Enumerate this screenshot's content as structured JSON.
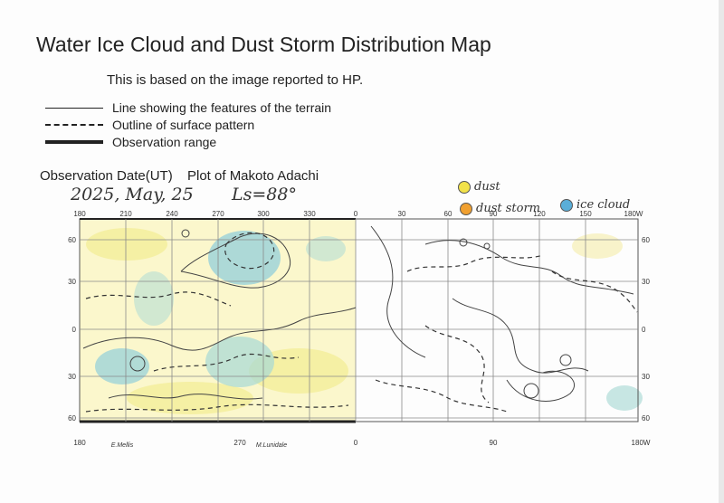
{
  "title": "Water Ice Cloud and Dust Storm Distribution Map",
  "subtitle": "This is based on the image reported to HP.",
  "legend": [
    {
      "style": "solid",
      "label": "Line showing the features of the terrain"
    },
    {
      "style": "dashed",
      "label": "Outline of surface pattern"
    },
    {
      "style": "thick",
      "label": "Observation range"
    }
  ],
  "observation": {
    "date_label": "Observation Date(UT)",
    "date_value": "2025, May, 25",
    "plot_label": "Plot of Makoto Adachi",
    "ls_value": "Ls=88°"
  },
  "key": [
    {
      "label": "dust",
      "color": "#f2e24a"
    },
    {
      "label": "dust storm",
      "color": "#f0a030"
    },
    {
      "label": "ice cloud",
      "color": "#5aaed8"
    }
  ],
  "map": {
    "top_longitudes": [
      "180",
      "210",
      "240",
      "270",
      "300",
      "330",
      "0",
      "30",
      "60",
      "90",
      "120",
      "150",
      "180W"
    ],
    "lat_left": [
      "60",
      "30",
      "0",
      "30",
      "60"
    ],
    "lat_right": [
      "60",
      "30",
      "0",
      "30",
      "60"
    ],
    "bottom_longitudes": [
      "180",
      "270",
      "0",
      "90",
      "180W"
    ],
    "bottom_sites": [
      "E.Mellis",
      "M.Lunidale"
    ],
    "colors": {
      "dust": "#f4ee9a",
      "ice": "#8fd0cf",
      "grid": "#8a8a8a",
      "frame": "#555555"
    }
  }
}
